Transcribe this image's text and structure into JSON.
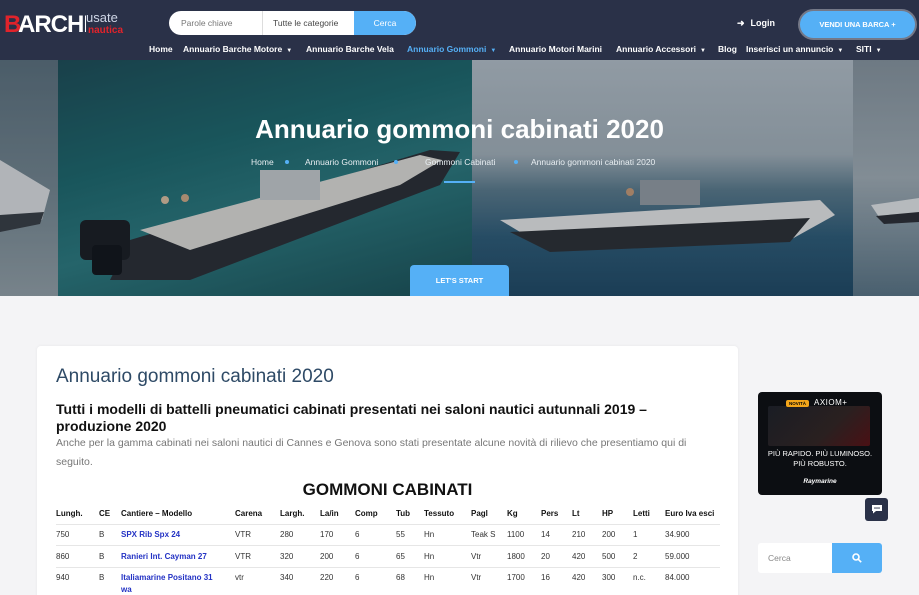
{
  "header": {
    "logo_main": "BARCHE",
    "logo_sub1": "usate",
    "logo_sub2": "nautica",
    "search_placeholder": "Parole chiave",
    "category_label": "Tutte le categorie",
    "search_button": "Cerca",
    "login_label": "Login",
    "sell_button": "VENDI UNA BARCA +"
  },
  "nav": [
    {
      "label": "Home",
      "caret": false,
      "active": false
    },
    {
      "label": "Annuario Barche Motore",
      "caret": true,
      "active": false
    },
    {
      "label": "Annuario Barche Vela",
      "caret": false,
      "active": false
    },
    {
      "label": "Annuario Gommoni",
      "caret": true,
      "active": true
    },
    {
      "label": "Annuario Motori Marini",
      "caret": false,
      "active": false
    },
    {
      "label": "Annuario Accessori",
      "caret": true,
      "active": false
    },
    {
      "label": "Blog",
      "caret": false,
      "active": false
    },
    {
      "label": "Inserisci un annuncio",
      "caret": true,
      "active": false
    },
    {
      "label": "SITI",
      "caret": true,
      "active": false
    }
  ],
  "hero": {
    "title": "Annuario gommoni cabinati 2020",
    "breadcrumb": [
      "Home",
      "Annuario Gommoni",
      "Gommoni Cabinati",
      "Annuario gommoni cabinati 2020"
    ],
    "start_button": "LET'S START"
  },
  "article": {
    "title": "Annuario gommoni cabinati 2020",
    "heading": "Tutti i modelli di battelli pneumatici cabinati presentati nei saloni nautici autunnali 2019 – produzione 2020",
    "intro": "Anche per la gamma cabinati nei saloni nautici di Cannes e Genova sono stati presentate alcune novità di rilievo che presentiamo qui di seguito.",
    "table_title": "GOMMONI CABINATI",
    "columns": [
      "Lungh.",
      "CE",
      "Cantiere – Modello",
      "Carena",
      "Largh.",
      "La/in",
      "Comp",
      "Tub",
      "Tessuto",
      "Pagl",
      "Kg",
      "Pers",
      "Lt",
      "HP",
      "Letti",
      "Euro Iva esci"
    ],
    "rows": [
      [
        "750",
        "B",
        "SPX Rib Spx 24",
        "VTR",
        "280",
        "170",
        "6",
        "55",
        "Hn",
        "Teak S",
        "1100",
        "14",
        "210",
        "200",
        "1",
        "34.900"
      ],
      [
        "860",
        "B",
        "Ranieri Int. Cayman 27",
        "VTR",
        "320",
        "200",
        "6",
        "65",
        "Hn",
        "Vtr",
        "1800",
        "20",
        "420",
        "500",
        "2",
        "59.000"
      ],
      [
        "940",
        "B",
        "Italiamarine Positano 31",
        "vtr",
        "340",
        "220",
        "6",
        "68",
        "Hn",
        "Vtr",
        "1700",
        "16",
        "420",
        "300",
        "n.c.",
        "84.000"
      ]
    ],
    "row3_model_cont": "wa"
  },
  "sidebar": {
    "ad_badge": "NOVITÀ",
    "ad_brand": "AXIOM+",
    "ad_line1": "PIÙ RAPIDO. PIÙ LUMINOSO.",
    "ad_line2": "PIÙ ROBUSTO.",
    "ad_logo": "Raymarine",
    "search_placeholder": "Cerca"
  },
  "colors": {
    "header_bg": "#2a3148",
    "accent": "#55b0f6",
    "logo_red": "#e0232b",
    "link": "#2332c4"
  }
}
